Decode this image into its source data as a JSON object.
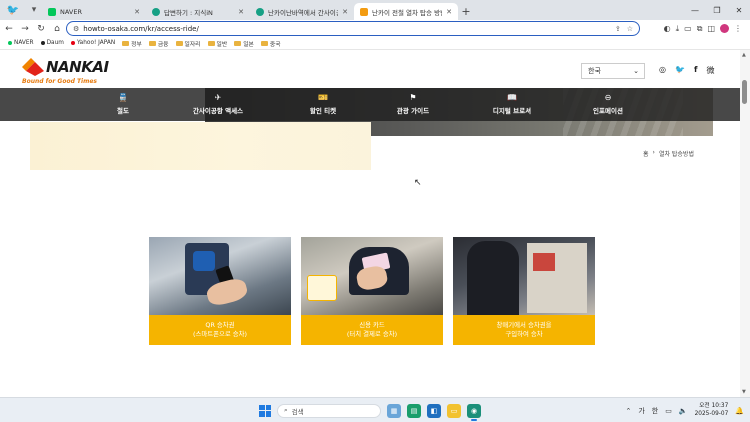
{
  "browser": {
    "tabs": [
      {
        "label": "NAVER",
        "favicon_color": "#03c75a",
        "active": false
      },
      {
        "label": "답변하기 : 지식iN",
        "favicon_color": "#16a085",
        "active": false
      },
      {
        "label": "난카이난바역에서 간사이공항 갈",
        "favicon_color": "#16a085",
        "active": false
      },
      {
        "label": "난카이 전철 열차 탑승 방법 | Fi",
        "favicon_color": "#f39c12",
        "active": true
      }
    ],
    "new_tab": "+",
    "window_controls": [
      "—",
      "❐",
      "✕"
    ],
    "url": {
      "host": "howto-osaka.com",
      "path": "/kr/access-ride/"
    },
    "bookmarks": [
      {
        "label": "NAVER",
        "type": "dot",
        "color": "#03c75a"
      },
      {
        "label": "Daum",
        "type": "dot",
        "color": "#222222"
      },
      {
        "label": "Yahoo! JAPAN",
        "type": "dot",
        "color": "#e60012"
      },
      {
        "label": "정부",
        "type": "folder"
      },
      {
        "label": "금융",
        "type": "folder"
      },
      {
        "label": "일자리",
        "type": "folder"
      },
      {
        "label": "일반",
        "type": "folder"
      },
      {
        "label": "일본",
        "type": "folder"
      },
      {
        "label": "중국",
        "type": "folder"
      }
    ]
  },
  "site": {
    "logo_word": "NANKAI",
    "logo_tagline": "Bound for Good Times",
    "language": "한국",
    "language_caret": "⌄",
    "social": [
      "◎",
      "🐦",
      "f",
      "微"
    ],
    "nav": [
      {
        "label": "철도",
        "icon": "train-icon",
        "glyph": "🚆"
      },
      {
        "label": "간사이공항 액세스",
        "icon": "plane-icon",
        "glyph": "✈"
      },
      {
        "label": "할인 티켓",
        "icon": "ticket-icon",
        "glyph": "🎫"
      },
      {
        "label": "관광 가이드",
        "icon": "signpost-icon",
        "glyph": "⚑"
      },
      {
        "label": "디지털 브로셔",
        "icon": "book-icon",
        "glyph": "📖"
      },
      {
        "label": "인포메이션",
        "icon": "info-icon",
        "glyph": "⊖"
      }
    ],
    "breadcrumb": {
      "home": "홈",
      "sep": "›",
      "current": "열차 탑승방법"
    },
    "cards": [
      {
        "line1": "QR 승차권",
        "line2": "(스마트폰으로 승차)"
      },
      {
        "line1": "신용 카드",
        "line2": "(터치 결제로 승차)"
      },
      {
        "line1": "창매기에서 승차권을",
        "line2": "구입하여 승차"
      }
    ]
  },
  "taskbar": {
    "search_placeholder": "검색",
    "tray_ime": "가",
    "tray_lang": "한",
    "clock_time": "오전 10:37",
    "clock_date": "2025-09-07"
  }
}
